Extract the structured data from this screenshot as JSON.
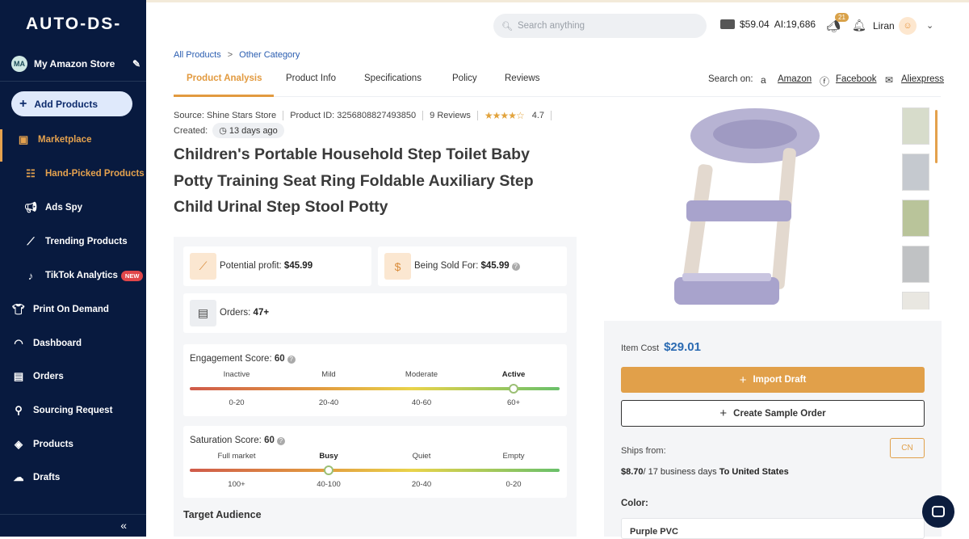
{
  "brand": {
    "logo_text": "AUTO-DS-"
  },
  "store": {
    "initials": "MA",
    "name": "My Amazon Store"
  },
  "sidebar": {
    "add_products": "Add Products",
    "items": [
      {
        "label": "Marketplace",
        "icon": "storefront-icon"
      },
      {
        "label": "Hand-Picked Products",
        "icon": "hand-picked-icon"
      },
      {
        "label": "Ads Spy",
        "icon": "megaphone-icon"
      },
      {
        "label": "Trending Products",
        "icon": "trending-chart-icon"
      },
      {
        "label": "TikTok Analytics",
        "icon": "tiktok-icon",
        "badge": "NEW"
      },
      {
        "label": "Print On Demand",
        "icon": "tshirt-icon"
      },
      {
        "label": "Dashboard",
        "icon": "gauge-icon"
      },
      {
        "label": "Orders",
        "icon": "orders-list-icon"
      },
      {
        "label": "Sourcing Request",
        "icon": "sourcing-user-icon"
      },
      {
        "label": "Products",
        "icon": "box-icon"
      },
      {
        "label": "Drafts",
        "icon": "cloud-upload-icon"
      }
    ],
    "collapse": "«"
  },
  "topbar": {
    "search_placeholder": "Search anything",
    "wallet": "$59.04",
    "ai_credits": "AI:19,686",
    "notifications": "21",
    "username": "Liran"
  },
  "breadcrumb": {
    "root": "All Products",
    "current": "Other Category"
  },
  "tabs": [
    "Product Analysis",
    "Product Info",
    "Specifications",
    "Policy",
    "Reviews"
  ],
  "search_on": {
    "label": "Search on:",
    "links": [
      "Amazon",
      "Facebook",
      "Aliexpress"
    ]
  },
  "product": {
    "source": "Source: Shine Stars Store",
    "product_id": "Product ID: 3256808827493850",
    "reviews": "9 Reviews",
    "rating": "4.7",
    "stars": "★★★★☆",
    "created_label": "Created:",
    "created_value": "13 days ago",
    "title": "Children's Portable Household Step Toilet Baby Potty Training Seat Ring Foldable Auxiliary Step Child Urinal Step Stool Potty"
  },
  "stats": {
    "profit_label": "Potential profit:",
    "profit_value": "$45.99",
    "sold_label": "Being Sold For:",
    "sold_value": "$45.99",
    "orders_label": "Orders:",
    "orders_value": "47+",
    "engagement": {
      "label": "Engagement Score:",
      "value": "60",
      "level": 0.87,
      "levels": [
        "Inactive",
        "Mild",
        "Moderate",
        "Active"
      ],
      "ranges": [
        "0-20",
        "20-40",
        "40-60",
        "60+"
      ],
      "active": "Active"
    },
    "saturation": {
      "label": "Saturation Score:",
      "value": "60",
      "level": 0.37,
      "levels": [
        "Full market",
        "Busy",
        "Quiet",
        "Empty"
      ],
      "ranges": [
        "100+",
        "40-100",
        "20-40",
        "0-20"
      ],
      "active": "Busy"
    },
    "target_audience": "Target Audience"
  },
  "purchase": {
    "item_cost_label": "Item Cost",
    "item_cost": "$29.01",
    "import_draft": "Import Draft",
    "create_sample": "Create Sample Order",
    "ships_from": "Ships from:",
    "ships_country": "CN",
    "shipping_cost": "$8.70",
    "shipping_days": "/ 17 business days",
    "shipping_dest": "To United States",
    "color_label": "Color:",
    "color_value": "Purple PVC"
  },
  "colors": {
    "sidebar": "#081a3f",
    "accent": "#e29a3f",
    "link": "#2a5db0",
    "price": "#2a6ab2"
  }
}
